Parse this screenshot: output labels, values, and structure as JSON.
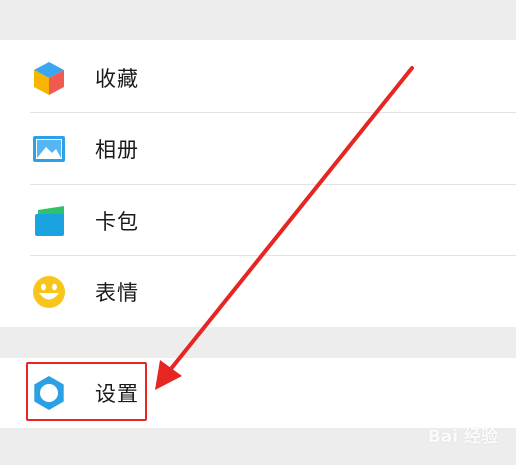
{
  "menu": {
    "items": [
      {
        "label": "收藏",
        "icon": "favorites-cube-icon"
      },
      {
        "label": "相册",
        "icon": "album-picture-icon"
      },
      {
        "label": "卡包",
        "icon": "card-wallet-icon"
      },
      {
        "label": "表情",
        "icon": "emoji-smile-icon"
      }
    ],
    "settings": {
      "label": "设置",
      "icon": "gear-icon"
    }
  },
  "annotation": {
    "color": "#e52622"
  },
  "watermark": {
    "text": "Bai 经验"
  }
}
